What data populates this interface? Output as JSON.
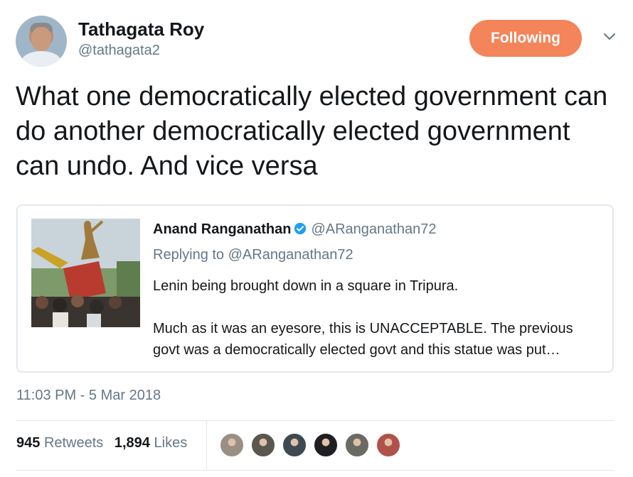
{
  "author": {
    "name": "Tathagata Roy",
    "handle": "@tathagata2",
    "follow_label": "Following"
  },
  "tweet_text": "What one democratically elected government can do another democratically elected government can undo. And vice versa",
  "quoted": {
    "name": "Anand Ranganathan",
    "handle": "@ARanganathan72",
    "replying_to": "Replying to @ARanganathan72",
    "paragraph1": "Lenin being brought down in a square in Tripura.",
    "paragraph2": "Much as it was an eyesore, this is UNACCEPTABLE. The previous govt was a democratically elected govt and this statue was put…"
  },
  "timestamp": "11:03 PM - 5 Mar 2018",
  "stats": {
    "retweets_count": "945",
    "retweets_label": "Retweets",
    "likes_count": "1,894",
    "likes_label": "Likes"
  },
  "colors": {
    "follow_button": "#f4845a",
    "verified": "#1da1f2",
    "secondary_text": "#657786"
  },
  "likers": [
    {
      "icon": "user-avatar-icon",
      "color": "#9a8f84"
    },
    {
      "icon": "user-avatar-icon",
      "color": "#5a5650"
    },
    {
      "icon": "user-avatar-icon",
      "color": "#3e4a52"
    },
    {
      "icon": "user-avatar-icon",
      "color": "#1f1f22"
    },
    {
      "icon": "user-avatar-icon",
      "color": "#6b6a63"
    },
    {
      "icon": "user-avatar-icon",
      "color": "#b0524a"
    }
  ]
}
